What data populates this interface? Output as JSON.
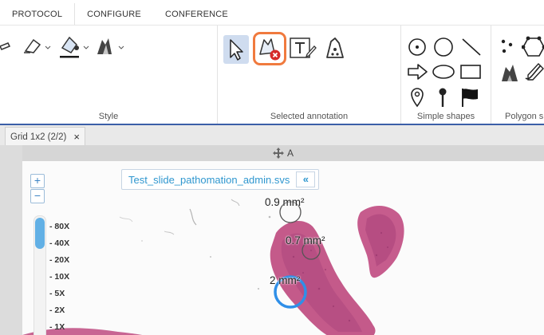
{
  "menu": {
    "tabs": [
      "PROTOCOL",
      "CONFIGURE",
      "CONFERENCE"
    ]
  },
  "ribbon": {
    "groups": {
      "style": "Style",
      "selected_annotation": "Selected annotation",
      "simple_shapes": "Simple shapes",
      "polygon": "Polygon s"
    }
  },
  "document_tab": {
    "label": "Grid 1x2 (2/2)",
    "close": "×"
  },
  "viewer": {
    "header_label": "A",
    "slide_name": "Test_slide_pathomation_admin.svs",
    "collapse_label": "«",
    "zoom_in": "+",
    "zoom_out": "−",
    "zoom_levels": [
      "80X",
      "40X",
      "20X",
      "10X",
      "5X",
      "2X",
      "1X"
    ],
    "zoom_level_fraction": 0.25,
    "annotations": [
      {
        "label": "0.9 mm²"
      },
      {
        "label": "0.7 mm²"
      },
      {
        "label": "2 mm²"
      }
    ]
  },
  "colors": {
    "accent_blue": "#2f97cf",
    "ribbon_border": "#3b5fa8",
    "highlight_orange": "#f07a3e",
    "tissue_pink": "#c45a8a",
    "delete_red": "#d62a2a"
  }
}
